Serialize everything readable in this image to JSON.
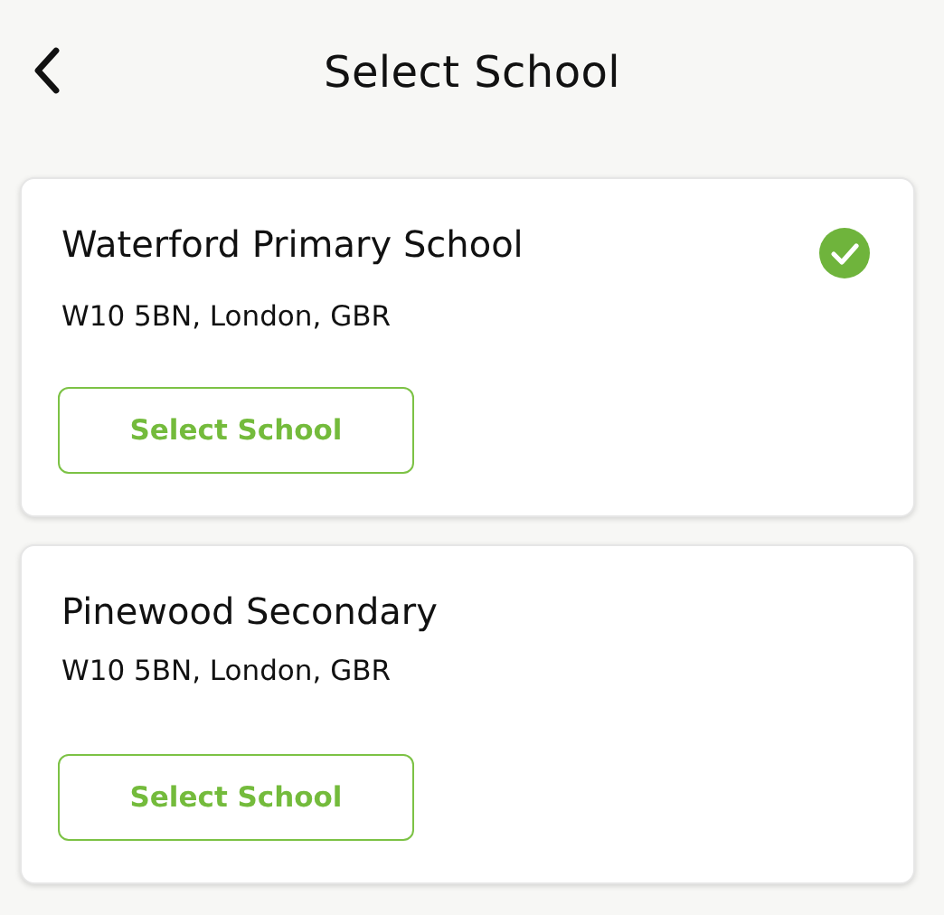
{
  "header": {
    "title": "Select School"
  },
  "schools": [
    {
      "name": "Waterford Primary School",
      "address": "W10 5BN, London, GBR",
      "selected": true,
      "button": "Select School"
    },
    {
      "name": "Pinewood Secondary",
      "address": "W10 5BN, London, GBR",
      "selected": false,
      "button": "Select School"
    }
  ]
}
